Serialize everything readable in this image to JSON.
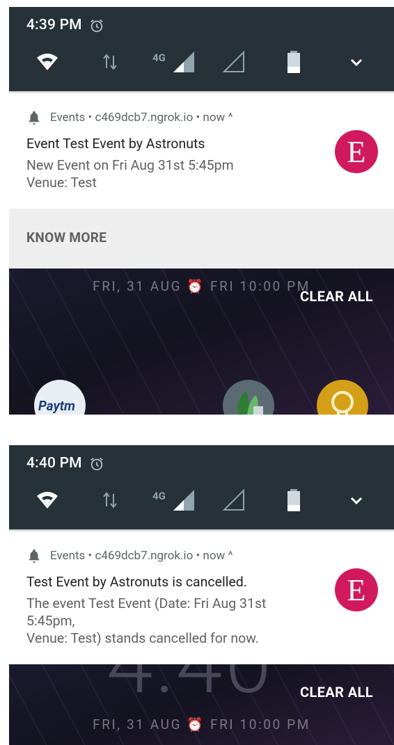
{
  "screen1": {
    "status": {
      "time": "4:39 PM",
      "network_label": "4G"
    },
    "notification": {
      "app_name": "Events",
      "source": "c469dcb7.ngrok.io",
      "when": "now",
      "header_text": "Events • c469dcb7.ngrok.io • now ^",
      "title": "Event Test Event by Astronuts",
      "body": "New Event on Fri Aug 31st 5:45pm\nVenue: Test",
      "avatar_letter": "E",
      "action_label": "KNOW MORE"
    },
    "lockscreen": {
      "date_line": "FRI, 31 AUG ⏰ FRI 10:00 PM",
      "clear_all_label": "CLEAR ALL",
      "app_label": "Paytm"
    }
  },
  "screen2": {
    "status": {
      "time": "4:40 PM",
      "network_label": "4G"
    },
    "notification": {
      "header_text": "Events • c469dcb7.ngrok.io • now ^",
      "title": "Test Event by Astronuts is cancelled.",
      "body": "The event Test Event (Date: Fri Aug 31st\n5:45pm,\nVenue: Test) stands cancelled for now.",
      "avatar_letter": "E"
    },
    "lockscreen": {
      "big_clock": "4:40",
      "date_line": "FRI, 31 AUG ⏰ FRI 10:00 PM",
      "clear_all_label": "CLEAR ALL"
    }
  },
  "colors": {
    "quick_settings_bg": "#263238",
    "avatar_bg": "#d11a5e",
    "action_bar_bg": "#eeeeee"
  },
  "icons": [
    "alarm-icon",
    "wifi-icon",
    "data-arrows-icon",
    "signal-full-icon",
    "signal-empty-icon",
    "battery-icon",
    "chevron-down-icon",
    "bell-icon"
  ]
}
